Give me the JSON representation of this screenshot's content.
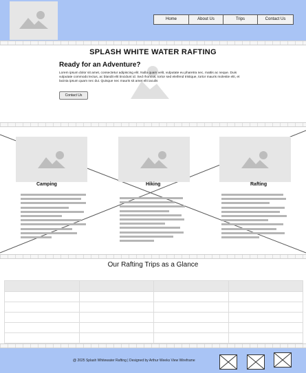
{
  "nav": {
    "items": [
      "Home",
      "About Us",
      "Trips",
      "Contact Us"
    ]
  },
  "hero": {
    "title": "SPLASH WHITE WATER RAFTING",
    "heading": "Ready for an Adventure?",
    "body": "Lorem ipsum dolor sit amet, consectetur adipiscing elit. Nulla quam velit, vulputate eu pharetra nec, mattis ac neque. Duis vulputate commodo lectus, ac blandit elit tincidunt id. Sed rhoncus, tortor sed eleifend tristique, tortor mauris molestie elit, et lacinia ipsum quam nec dui. Quisque nec mauris sit amet elit iaculis",
    "button": "Contact Us"
  },
  "features": [
    {
      "title": "Camping"
    },
    {
      "title": "Hiking"
    },
    {
      "title": "Rafting"
    }
  ],
  "trips": {
    "title": "Our Rafting Trips as a Glance"
  },
  "footer": {
    "copyright": "@ 2025 Splash Whitewater Rafting | Designed by Arthur Weeks View Wireframe"
  },
  "colors": {
    "header_bg": "#a9c4f5",
    "placeholder": "#e6e6e6",
    "icon": "#bdbdbd"
  }
}
